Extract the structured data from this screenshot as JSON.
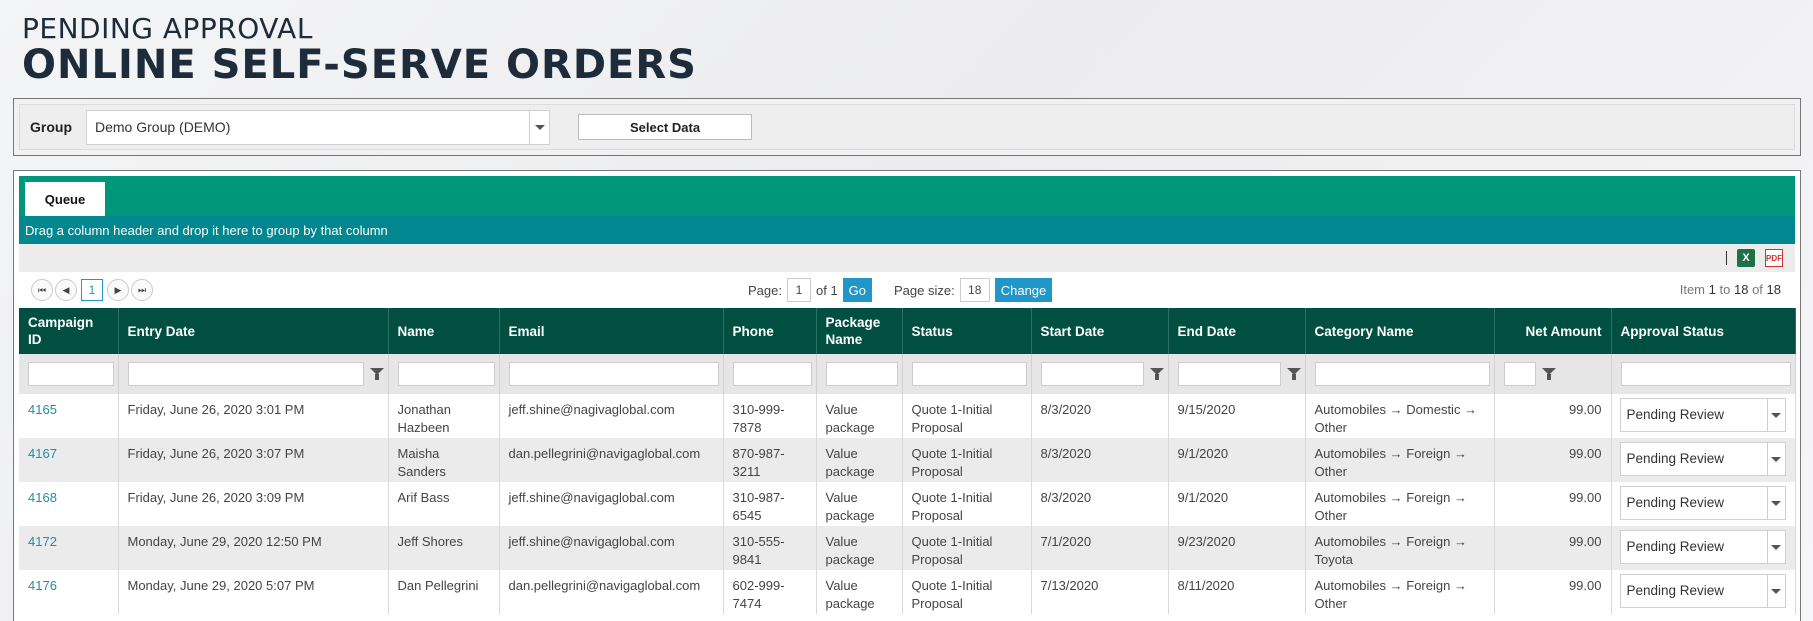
{
  "header": {
    "subtitle": "PENDING APPROVAL",
    "title": "ONLINE SELF-SERVE ORDERS"
  },
  "group_filter": {
    "label": "Group",
    "selected": "Demo Group (DEMO)",
    "select_button": "Select Data"
  },
  "tabs": [
    {
      "label": "Queue"
    }
  ],
  "group_drop_hint": "Drag a column header and drop it here to group by that column",
  "toolbar": {
    "excel_icon": "excel-export-icon",
    "pdf_icon": "pdf-export-icon",
    "pdf_text": "PDF",
    "excel_text": "X"
  },
  "pager": {
    "current_page": "1",
    "page_label": "Page:",
    "page_input": "1",
    "of_label": "of 1",
    "go_label": "Go",
    "page_size_label": "Page size:",
    "page_size": "18",
    "change_label": "Change",
    "info_prefix": "Item",
    "info_from": "1",
    "info_to_label": "to",
    "info_to": "18",
    "info_of_label": "of",
    "info_total": "18",
    "nav_first": "⏮",
    "nav_prev": "◀",
    "nav_next": "▶",
    "nav_last": "⏭"
  },
  "columns": [
    "Campaign ID",
    "Entry Date",
    "Name",
    "Email",
    "Phone",
    "Package Name",
    "Status",
    "Start Date",
    "End Date",
    "Category Name",
    "Net Amount",
    "Approval Status"
  ],
  "rows": [
    {
      "id": "4165",
      "entry": "Friday, June 26, 2020 3:01 PM",
      "name": "Jonathan Hazbeen",
      "email": "jeff.shine@nagivaglobal.com",
      "phone": "310-999-7878",
      "package": "Value package",
      "status": "Quote 1-Initial Proposal",
      "start": "8/3/2020",
      "end": "9/15/2020",
      "category": "Automobiles → Domestic → Other",
      "net": "99.00",
      "approval": "Pending Review"
    },
    {
      "id": "4167",
      "entry": "Friday, June 26, 2020 3:07 PM",
      "name": "Maisha Sanders",
      "email": "dan.pellegrini@navigaglobal.com",
      "phone": "870-987-3211",
      "package": "Value package",
      "status": "Quote 1-Initial Proposal",
      "start": "8/3/2020",
      "end": "9/1/2020",
      "category": "Automobiles → Foreign → Other",
      "net": "99.00",
      "approval": "Pending Review"
    },
    {
      "id": "4168",
      "entry": "Friday, June 26, 2020 3:09 PM",
      "name": "Arif Bass",
      "email": "jeff.shine@navigaglobal.com",
      "phone": "310-987-6545",
      "package": "Value package",
      "status": "Quote 1-Initial Proposal",
      "start": "8/3/2020",
      "end": "9/1/2020",
      "category": "Automobiles → Foreign → Other",
      "net": "99.00",
      "approval": "Pending Review"
    },
    {
      "id": "4172",
      "entry": "Monday, June 29, 2020 12:50 PM",
      "name": "Jeff Shores",
      "email": "jeff.shine@navigaglobal.com",
      "phone": "310-555-9841",
      "package": "Value package",
      "status": "Quote 1-Initial Proposal",
      "start": "7/1/2020",
      "end": "9/23/2020",
      "category": "Automobiles → Foreign → Toyota",
      "net": "99.00",
      "approval": "Pending Review"
    },
    {
      "id": "4176",
      "entry": "Monday, June 29, 2020 5:07 PM",
      "name": "Dan Pellegrini",
      "email": "dan.pellegrini@navigaglobal.com",
      "phone": "602-999-7474",
      "package": "Value package",
      "status": "Quote 1-Initial Proposal",
      "start": "7/13/2020",
      "end": "8/11/2020",
      "category": "Automobiles → Foreign → Other",
      "net": "99.00",
      "approval": "Pending Review"
    }
  ]
}
